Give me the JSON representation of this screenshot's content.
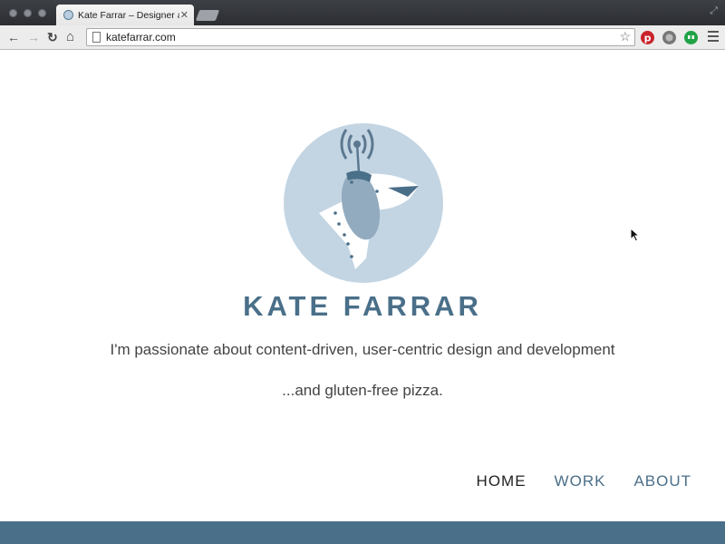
{
  "browser": {
    "tab_title": "Kate Farrar – Designer and Developer",
    "tab_close": "✕",
    "url": "katefarrar.com",
    "back": "←",
    "forward": "→",
    "reload": "↻",
    "home": "⌂",
    "star": "☆",
    "fullscreen": "⤢"
  },
  "page": {
    "name": "KATE FARRAR",
    "tagline": "I'm passionate about content-driven, user-centric design and development",
    "tagline2": "...and gluten-free pizza.",
    "nav": {
      "home": "HOME",
      "work": "WORK",
      "about": "ABOUT"
    }
  },
  "colors": {
    "brand": "#4a6f89",
    "logo_circle": "#c3d5e3",
    "footer": "#4a6f89"
  },
  "icons": {
    "logo": "robot-dog-logo",
    "extensions": [
      "pinterest-icon",
      "extension-icon",
      "hangouts-icon"
    ]
  }
}
